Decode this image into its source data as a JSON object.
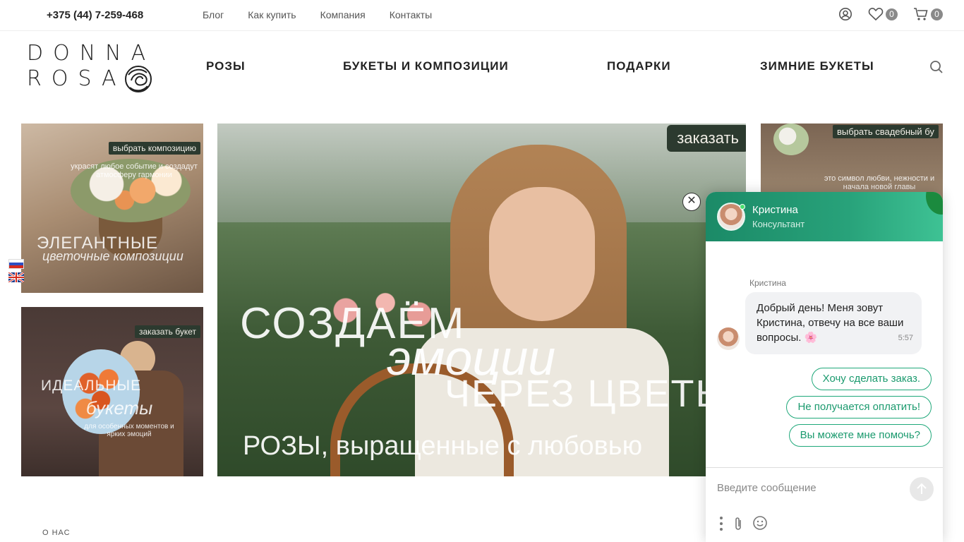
{
  "topbar": {
    "phone": "+375 (44) 7-259-468",
    "links": [
      "Блог",
      "Как купить",
      "Компания",
      "Контакты"
    ],
    "favorites_count": "0",
    "cart_count": "0"
  },
  "logo": {
    "line1": "DONNA",
    "line2": "ROSA"
  },
  "nav": {
    "items": [
      "РОЗЫ",
      "БУКЕТЫ И КОМПОЗИЦИИ",
      "ПОДАРКИ",
      "ЗИМНИЕ БУКЕТЫ"
    ]
  },
  "banners": {
    "left_top": {
      "tag": "выбрать композицию",
      "caption_small": "украсят любое событие и создадут атмосферу гармонии",
      "caption_big1": "ЭЛЕГАНТНЫЕ",
      "caption_big2": "цветочные композиции"
    },
    "left_bottom": {
      "tag": "заказать букет",
      "caption_big1": "ИДЕАЛЬНЫЕ",
      "caption_big2": "букеты",
      "caption_small": "для особенных моментов и ярких эмоций"
    },
    "center": {
      "tag": "заказать",
      "headline1": "СОЗДАЁМ",
      "headline2": "эмоции",
      "headline3": "ЧЕРЕЗ ЦВЕТЫ",
      "subline": "РОЗЫ, выращенные с любовью"
    },
    "right": {
      "tag": "выбрать свадебный бу",
      "caption_small": "это символ любви, нежности и начала новой главы"
    }
  },
  "chat": {
    "agent_name": "Кристина",
    "agent_role": "Консультант",
    "message_author": "Кристина",
    "message_text": "Добрый день! Меня зовут Кристина, отвечу на все ваши вопросы. 🌸",
    "message_time": "5:57",
    "quick_replies": [
      "Хочу сделать заказ.",
      "Не получается оплатить!",
      "Вы можете мне помочь?"
    ],
    "input_placeholder": "Введите сообщение",
    "accent": "#1fa87a"
  },
  "section": {
    "about_label": "О НАС"
  }
}
